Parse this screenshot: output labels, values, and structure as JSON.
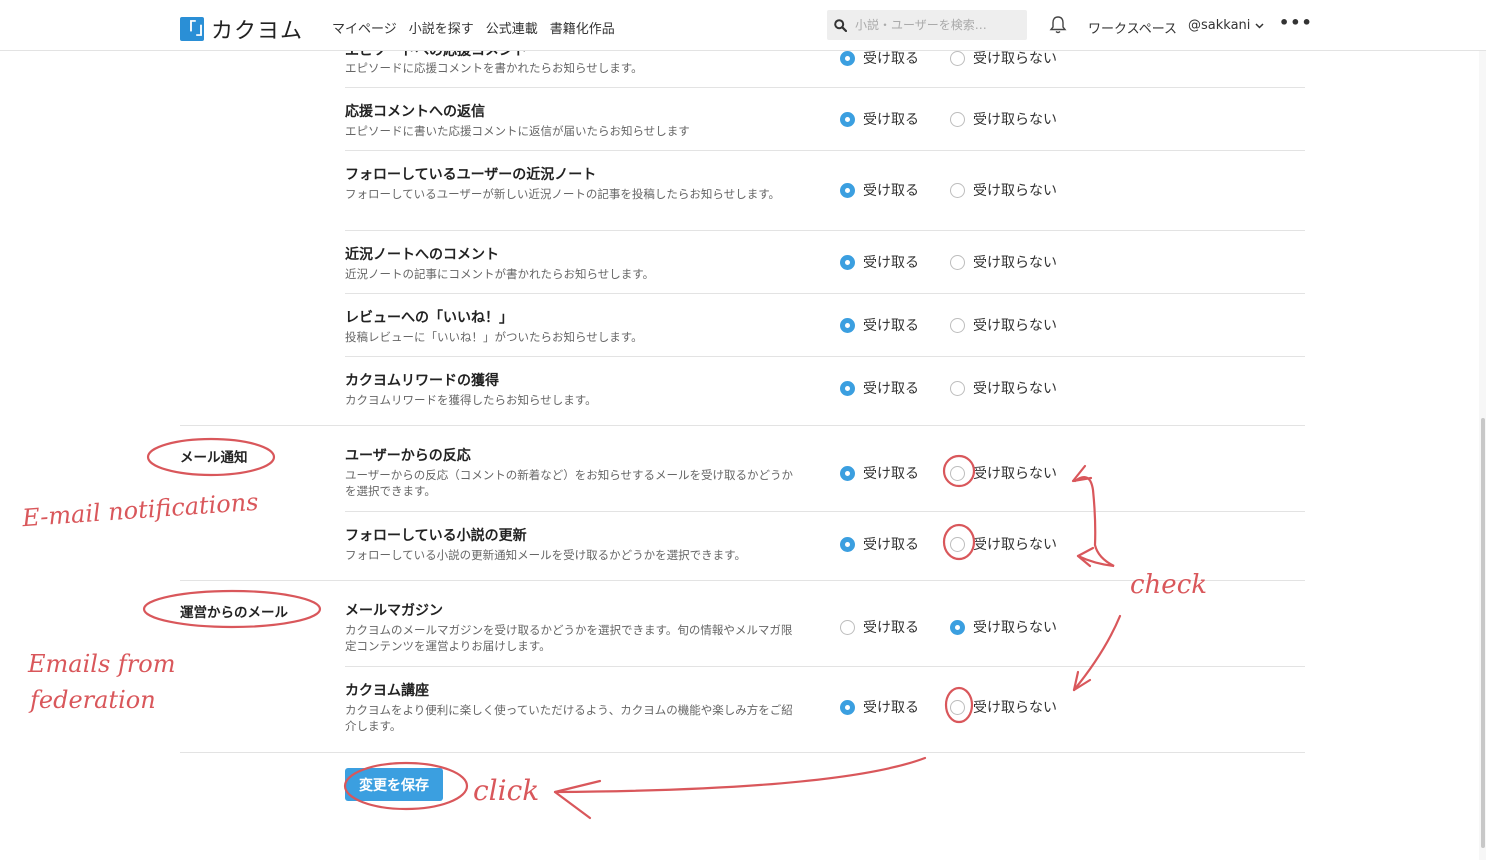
{
  "header": {
    "logo_mark": "「」",
    "logo_text": "カクヨム",
    "nav": [
      "マイページ",
      "小説を探す",
      "公式連載",
      "書籍化作品"
    ],
    "search_placeholder": "小説・ユーザーを検索…",
    "workspace": "ワークスペース",
    "user": "@sakkani",
    "more": "•••"
  },
  "options": {
    "accept": "受け取る",
    "decline": "受け取らない"
  },
  "rows": [
    {
      "title": "エピソードへの応援コメント",
      "desc": "エピソードに応援コメントを書かれたらお知らせします。",
      "selected": "accept"
    },
    {
      "title": "応援コメントへの返信",
      "desc": "エピソードに書いた応援コメントに返信が届いたらお知らせします",
      "selected": "accept"
    },
    {
      "title": "フォローしているユーザーの近況ノート",
      "desc": "フォローしているユーザーが新しい近況ノートの記事を投稿したらお知らせします。",
      "selected": "accept"
    },
    {
      "title": "近況ノートへのコメント",
      "desc": "近況ノートの記事にコメントが書かれたらお知らせします。",
      "selected": "accept"
    },
    {
      "title": "レビューへの「いいね！」",
      "desc": "投稿レビューに「いいね！」がついたらお知らせします。",
      "selected": "accept"
    },
    {
      "title": "カクヨムリワードの獲得",
      "desc": "カクヨムリワードを獲得したらお知らせします。",
      "selected": "accept"
    },
    {
      "title": "ユーザーからの反応",
      "desc": "ユーザーからの反応（コメントの新着など）をお知らせするメールを受け取るかどうかを選択できます。",
      "selected": "accept"
    },
    {
      "title": "フォローしている小説の更新",
      "desc": "フォローしている小説の更新通知メールを受け取るかどうかを選択できます。",
      "selected": "accept"
    },
    {
      "title": "メールマガジン",
      "desc": "カクヨムのメールマガジンを受け取るかどうかを選択できます。旬の情報やメルマガ限定コンテンツを運営よりお届けします。",
      "selected": "decline"
    },
    {
      "title": "カクヨム講座",
      "desc": "カクヨムをより便利に楽しく使っていただけるよう、カクヨムの機能や楽しみ方をご紹介します。",
      "selected": "accept"
    }
  ],
  "sections": {
    "email": "メール通知",
    "operator": "運営からのメール"
  },
  "save_label": "変更を保存",
  "annotations": {
    "email": "E-mail notifications",
    "operator_line1": "Emails from",
    "operator_line2": "federation",
    "check": "check",
    "click": "click"
  },
  "colors": {
    "accent": "#3b9fe0",
    "annotation": "#d9575b"
  }
}
